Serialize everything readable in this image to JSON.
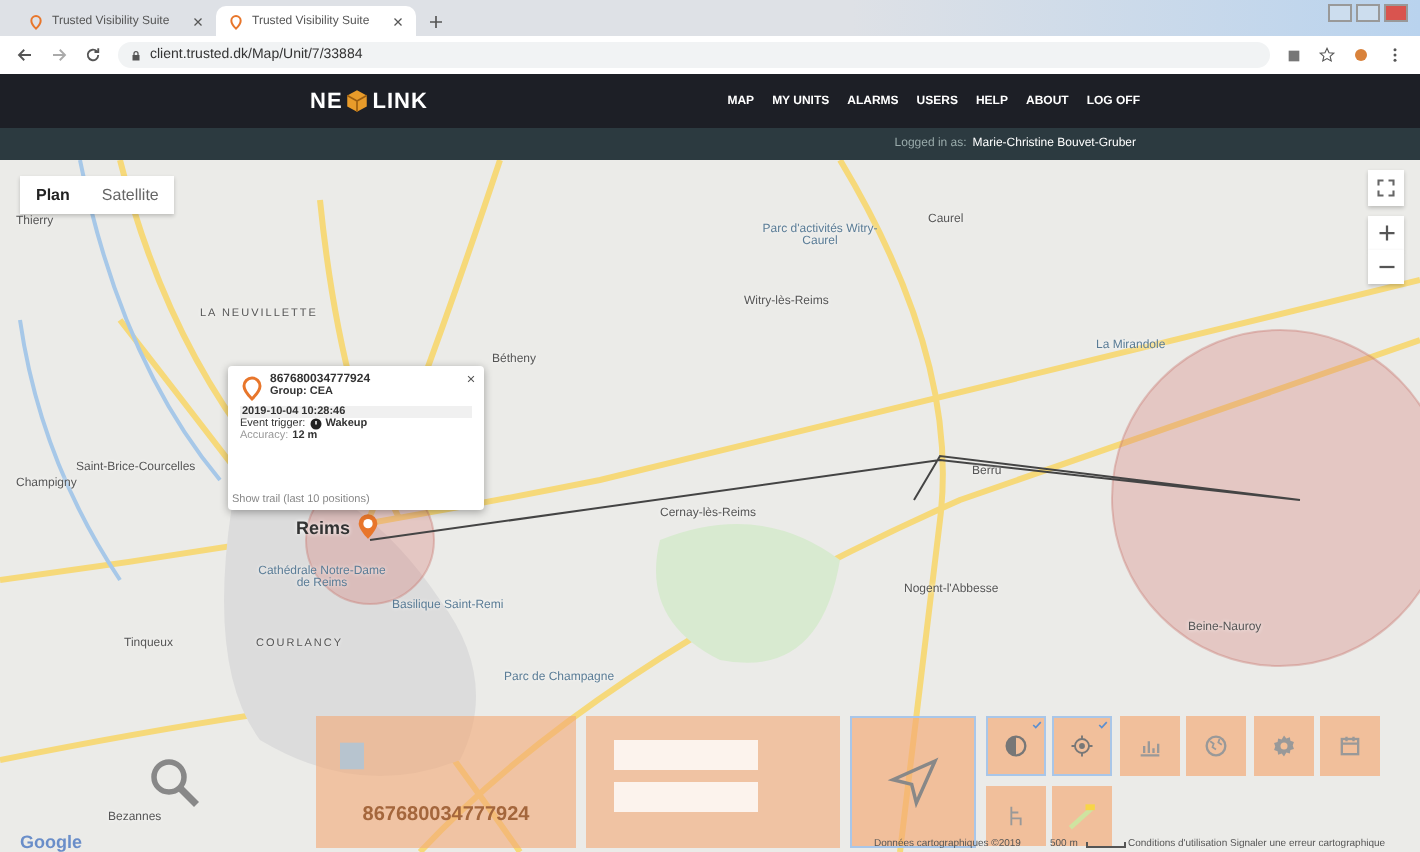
{
  "browser": {
    "tabs": [
      {
        "title": "Trusted Visibility Suite",
        "selected": false
      },
      {
        "title": "Trusted Visibility Suite",
        "selected": true
      }
    ],
    "url": "client.trusted.dk/Map/Unit/7/33884"
  },
  "nav": {
    "logo_left": "NE",
    "logo_right": "LINK",
    "items": [
      "MAP",
      "MY UNITS",
      "ALARMS",
      "USERS",
      "HELP",
      "ABOUT",
      "LOG OFF"
    ]
  },
  "user_bar": {
    "label": "Logged in as:",
    "name": "Marie-Christine Bouvet-Gruber"
  },
  "map": {
    "types": [
      {
        "label": "Plan",
        "selected": true
      },
      {
        "label": "Satellite",
        "selected": false
      }
    ],
    "places": [
      {
        "name": "Thierry",
        "kind": "town"
      },
      {
        "name": "LA NEUVILLETTE",
        "kind": "district"
      },
      {
        "name": "Bétheny",
        "kind": "town"
      },
      {
        "name": "Parc d'activités Witry-Caurel",
        "kind": "poi"
      },
      {
        "name": "Caurel",
        "kind": "town"
      },
      {
        "name": "Witry-lès-Reims",
        "kind": "town"
      },
      {
        "name": "La Mirandole",
        "kind": "poi"
      },
      {
        "name": "Saint-Brice-Courcelles",
        "kind": "town"
      },
      {
        "name": "Champigny",
        "kind": "town"
      },
      {
        "name": "Berru",
        "kind": "town"
      },
      {
        "name": "Cernay-lès-Reims",
        "kind": "town"
      },
      {
        "name": "Reims",
        "kind": "city"
      },
      {
        "name": "Cathédrale Notre-Dame de Reims",
        "kind": "poi"
      },
      {
        "name": "Nogent-l'Abbesse",
        "kind": "town"
      },
      {
        "name": "Beine-Nauroy",
        "kind": "town"
      },
      {
        "name": "Tinqueux",
        "kind": "town"
      },
      {
        "name": "COURLANCY",
        "kind": "district"
      },
      {
        "name": "Basilique Saint-Remi",
        "kind": "poi"
      },
      {
        "name": "Parc de Champagne",
        "kind": "poi"
      },
      {
        "name": "Bezannes",
        "kind": "town"
      }
    ],
    "popup": {
      "device_id": "867680034777924",
      "group": "Group: CEA",
      "timestamp": "2019-10-04 10:28:46",
      "event_label": "Event trigger:",
      "event_value": "Wakeup",
      "accuracy_label": "Accuracy:",
      "accuracy_value": "12 m",
      "trail_link": "Show trail (last 10 positions)"
    },
    "footer": {
      "brand": "Google",
      "attribution": "Données cartographiques ©2019",
      "scale": "500 m",
      "terms": "Conditions d'utilisation",
      "report": "Signaler une erreur cartographique"
    }
  },
  "panel": {
    "device_id": "867680034777924",
    "tiles": [
      {
        "kind": "contrast",
        "selected": true
      },
      {
        "kind": "locate",
        "selected": true
      },
      {
        "kind": "chart",
        "selected": false
      },
      {
        "kind": "globe",
        "selected": false
      },
      {
        "kind": "gear",
        "selected": false
      },
      {
        "kind": "calendar",
        "selected": false
      },
      {
        "kind": "chair",
        "selected": false
      },
      {
        "kind": "map",
        "selected": false
      }
    ]
  }
}
